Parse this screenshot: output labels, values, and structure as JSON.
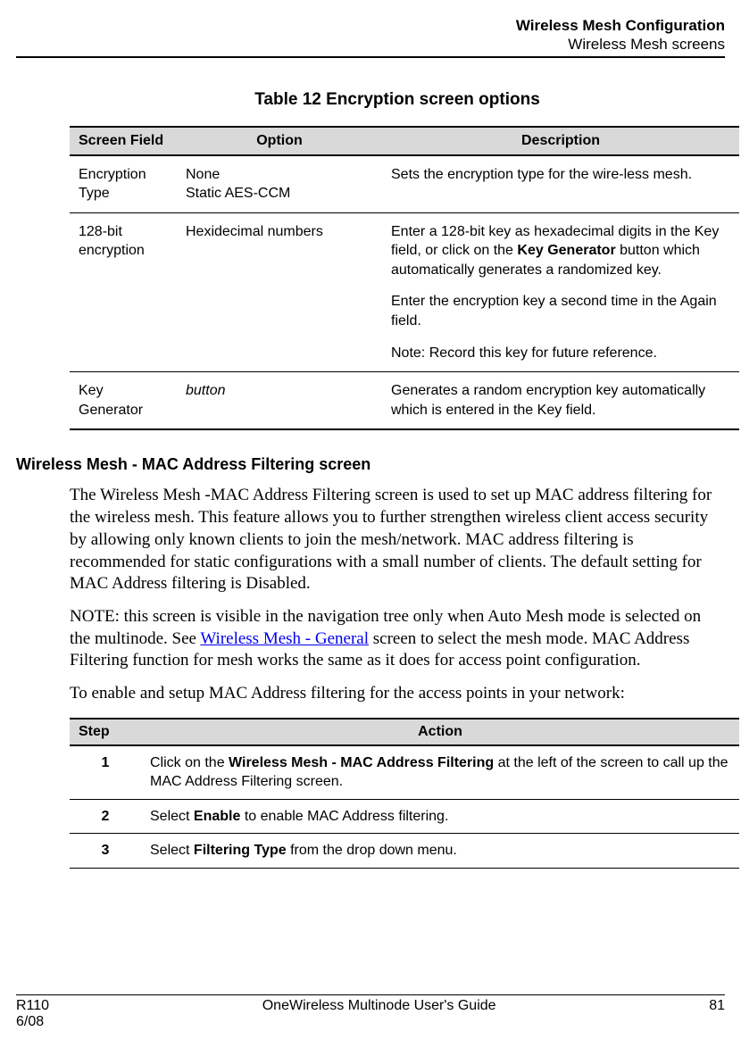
{
  "header": {
    "title": "Wireless Mesh Configuration",
    "subtitle": "Wireless Mesh screens"
  },
  "table12": {
    "caption": "Table 12  Encryption screen options",
    "headers": {
      "field": "Screen Field",
      "option": "Option",
      "desc": "Description"
    },
    "rows": [
      {
        "field": "Encryption Type",
        "option": "None\nStatic AES-CCM",
        "desc": [
          {
            "html": "Sets the encryption type for the wire-less mesh."
          }
        ]
      },
      {
        "field": "128-bit encryption",
        "option": "Hexidecimal numbers",
        "desc": [
          {
            "html": "Enter a 128-bit key as hexadecimal digits in the Key field, or click on the <b>Key Generator</b> button which automatically generates a randomized key."
          },
          {
            "html": "Enter the encryption key a second time in the Again field."
          },
          {
            "html": "Note:  Record this key for future reference."
          }
        ]
      },
      {
        "field": "Key Generator",
        "option_italic": "button",
        "desc": [
          {
            "html": "Generates a random encryption key automatically which is entered in the Key field."
          }
        ]
      }
    ]
  },
  "section": {
    "heading": "Wireless Mesh - MAC Address Filtering screen",
    "para1": "The Wireless Mesh -MAC Address Filtering screen is used to set up MAC address filtering for the wireless mesh. This feature allows you to further strengthen wireless client access security by allowing only known clients to join the mesh/network.  MAC address filtering is recommended for static configurations with a small number of clients.  The default setting for MAC Address filtering is Disabled.",
    "para2_pre": "NOTE:  this screen is visible in the navigation tree only when Auto Mesh mode is selected on the multinode.  See ",
    "para2_link": "Wireless Mesh - General",
    "para2_post": " screen to select the mesh mode. MAC Address Filtering function for mesh works the same as it does for access point configuration.",
    "para3": "To enable and setup MAC Address filtering for the access points in your network:"
  },
  "steps": {
    "headers": {
      "step": "Step",
      "action": "Action"
    },
    "rows": [
      {
        "num": "1",
        "action_html": "Click on the <b>Wireless Mesh - MAC Address Filtering</b> at the left of the screen to call up the MAC Address Filtering screen."
      },
      {
        "num": "2",
        "action_html": "Select <b>Enable</b> to enable MAC Address filtering."
      },
      {
        "num": "3",
        "action_html": "Select <b>Filtering Type</b> from the drop down menu."
      }
    ]
  },
  "footer": {
    "left1": "R110",
    "left2": "6/08",
    "center": "OneWireless Multinode User's Guide",
    "right": "81"
  }
}
